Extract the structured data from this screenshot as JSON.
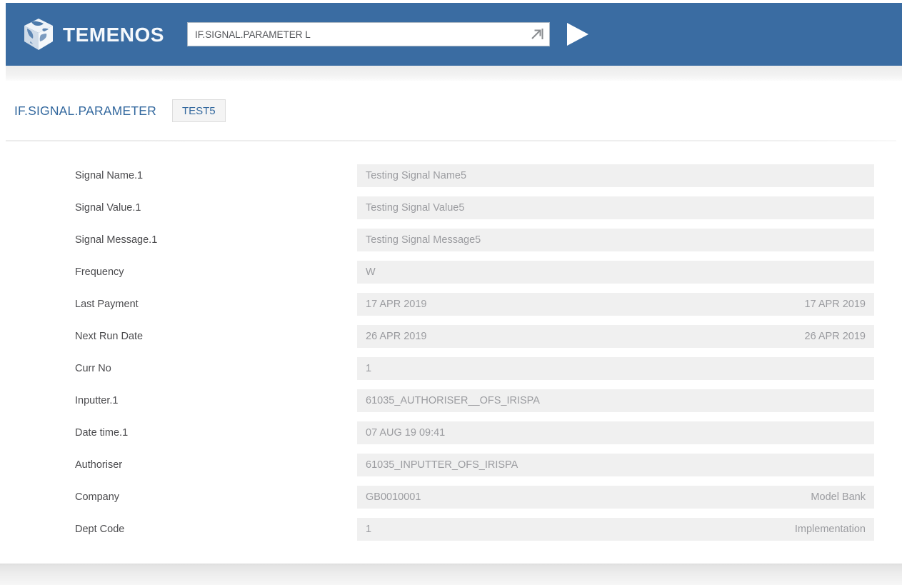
{
  "header": {
    "logo_text": "TEMENOS",
    "command": {
      "value": "IF.SIGNAL.PARAMETER L"
    },
    "icons": {
      "goto": "goto-arrow-icon",
      "run": "play-icon",
      "logo": "temenos-globe-icon"
    }
  },
  "page": {
    "title": "IF.SIGNAL.PARAMETER",
    "record_id": "TEST5"
  },
  "form": {
    "rows": [
      {
        "label": "Signal Name.1",
        "value": "Testing Signal Name5",
        "value_right": ""
      },
      {
        "label": "Signal Value.1",
        "value": "Testing Signal Value5",
        "value_right": ""
      },
      {
        "label": "Signal Message.1",
        "value": "Testing Signal Message5",
        "value_right": ""
      },
      {
        "label": "Frequency",
        "value": "W",
        "value_right": ""
      },
      {
        "label": "Last Payment",
        "value": "17 APR 2019",
        "value_right": "17 APR 2019"
      },
      {
        "label": "Next Run Date",
        "value": "26 APR 2019",
        "value_right": "26 APR 2019"
      },
      {
        "label": "Curr No",
        "value": "1",
        "value_right": ""
      },
      {
        "label": "Inputter.1",
        "value": "61035_AUTHORISER__OFS_IRISPA",
        "value_right": ""
      },
      {
        "label": "Date time.1",
        "value": "07 AUG 19 09:41",
        "value_right": ""
      },
      {
        "label": "Authoriser",
        "value": "61035_INPUTTER_OFS_IRISPA",
        "value_right": ""
      },
      {
        "label": "Company",
        "value": "GB0010001",
        "value_right": "Model Bank"
      },
      {
        "label": "Dept Code",
        "value": "1",
        "value_right": "Implementation"
      }
    ]
  },
  "colors": {
    "header_bg": "#3a6ca2",
    "accent_text": "#33689e",
    "field_bg": "#f0f0f0",
    "field_text": "#9b9ca0",
    "label_text": "#4b4b4e"
  }
}
